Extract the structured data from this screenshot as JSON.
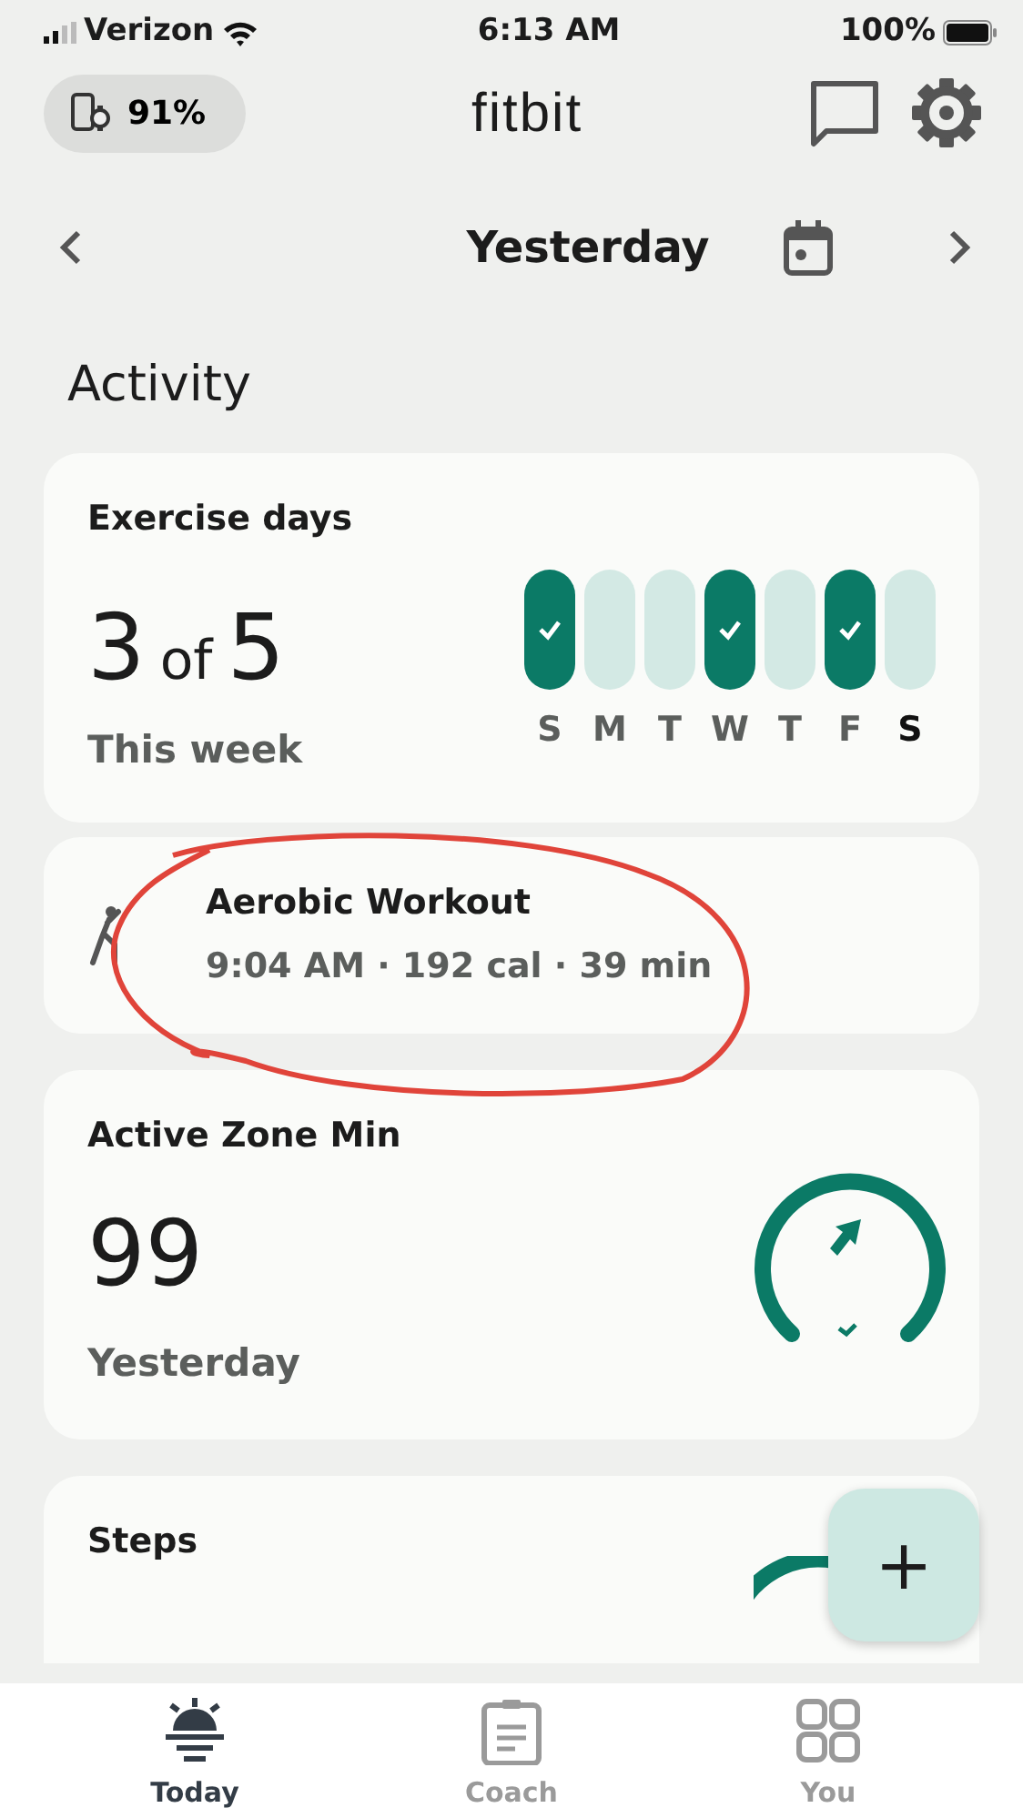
{
  "status_bar": {
    "carrier": "Verizon",
    "time": "6:13 AM",
    "battery": "100%"
  },
  "header": {
    "device_battery": "91%",
    "logo": "fitbit"
  },
  "date_nav": {
    "label": "Yesterday"
  },
  "section_title": "Activity",
  "exercise_days": {
    "title": "Exercise days",
    "count": "3",
    "of": "of",
    "goal": "5",
    "subtitle": "This week",
    "days": [
      {
        "label": "S",
        "done": true,
        "today": false
      },
      {
        "label": "M",
        "done": false,
        "today": false
      },
      {
        "label": "T",
        "done": false,
        "today": false
      },
      {
        "label": "W",
        "done": true,
        "today": false
      },
      {
        "label": "T",
        "done": false,
        "today": false
      },
      {
        "label": "F",
        "done": true,
        "today": false
      },
      {
        "label": "S",
        "done": false,
        "today": true
      }
    ]
  },
  "workout": {
    "title": "Aerobic Workout",
    "details": "9:04 AM · 192 cal · 39 min"
  },
  "active_zone": {
    "title": "Active Zone Min",
    "value": "99",
    "subtitle": "Yesterday",
    "goal_met": true
  },
  "steps": {
    "title": "Steps"
  },
  "fab": {
    "label": "+"
  },
  "bottom_nav": [
    {
      "label": "Today",
      "kind": "today",
      "selected": true
    },
    {
      "label": "Coach",
      "kind": "coach",
      "selected": false
    },
    {
      "label": "You",
      "kind": "you",
      "selected": false
    }
  ]
}
